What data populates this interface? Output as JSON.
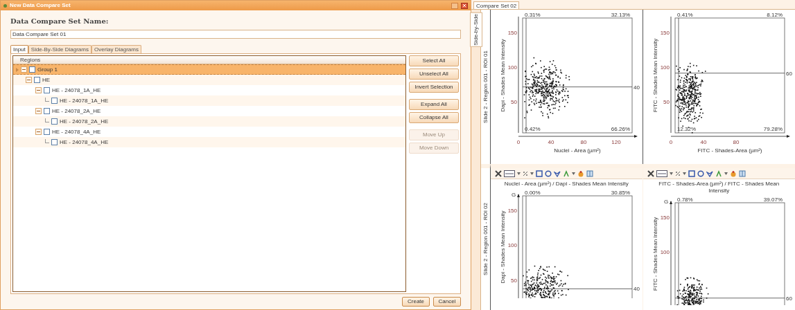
{
  "dialog": {
    "title": "New Data Compare Set",
    "name_label": "Data Compare Set Name:",
    "name_value": "Data Compare Set 01",
    "tabs": [
      {
        "label": "Input",
        "selected": true
      },
      {
        "label": "Side-By-Side Diagrams",
        "selected": false
      },
      {
        "label": "Overlay Diagrams",
        "selected": false
      }
    ],
    "tree": {
      "column": "Regions",
      "items": [
        {
          "label": "Group 1",
          "checked": false,
          "expanded": true,
          "selected": true,
          "children": [
            {
              "label": "HE",
              "checked": false,
              "expanded": true,
              "selected": false,
              "children": [
                {
                  "label": "HE - 24078_1A_HE",
                  "checked": false,
                  "expanded": true,
                  "selected": false,
                  "children": [
                    {
                      "label": "HE - 24078_1A_HE",
                      "checked": false,
                      "selected": false
                    }
                  ]
                },
                {
                  "label": "HE - 24078_2A_HE",
                  "checked": false,
                  "expanded": true,
                  "selected": false,
                  "children": [
                    {
                      "label": "HE - 24078_2A_HE",
                      "checked": false,
                      "selected": false
                    }
                  ]
                },
                {
                  "label": "HE - 24078_4A_HE",
                  "checked": false,
                  "expanded": true,
                  "selected": false,
                  "children": [
                    {
                      "label": "HE - 24078_4A_HE",
                      "checked": false,
                      "selected": false
                    }
                  ]
                }
              ]
            }
          ]
        }
      ]
    },
    "side_buttons": [
      {
        "label": "Select All",
        "disabled": false
      },
      {
        "label": "Unselect All",
        "disabled": false
      },
      {
        "label": "Invert Selection",
        "disabled": false
      },
      {
        "label": "Expand All",
        "disabled": false
      },
      {
        "label": "Collapse All",
        "disabled": false
      },
      {
        "label": "Move Up",
        "disabled": true
      },
      {
        "label": "Move Down",
        "disabled": true
      }
    ],
    "footer_buttons": [
      "Create",
      "Cancel"
    ]
  },
  "compare": {
    "tab": "Compare Set 02",
    "side_tab": "Side-by-Side",
    "row_labels": [
      "Slide 2 - Region 001 - ROI 01",
      "Slide 2 - Region 001 - ROI 02"
    ],
    "plots": [
      {
        "toolbar": false,
        "ylabel": "Dapi - Shades Mean Intensity",
        "xlabel": "Nuclei - Area (µm²)",
        "yticks": [
          "150",
          "100",
          "50"
        ],
        "xticks": [
          "0",
          "40",
          "80",
          "120"
        ],
        "gate": "40",
        "corners": [
          "0.31%",
          "32.13%",
          "0.42%",
          "66.26%"
        ]
      },
      {
        "toolbar": false,
        "ylabel": "FITC - Shades Mean Intensity",
        "xlabel": "FITC - Shades-Area (µm²)",
        "yticks": [
          "150",
          "100",
          "50"
        ],
        "xticks": [
          "0",
          "40",
          "80"
        ],
        "gate": "60",
        "corners": [
          "0.41%",
          "8.12%",
          "12.32%",
          "79.28%"
        ]
      },
      {
        "toolbar": true,
        "title": "Nuclei - Area (µm²) / Dapi - Shades Mean Intensity",
        "axis_mark": "G",
        "ylabel": "Dapi - Shades Mean Intensity",
        "yticks": [
          "150",
          "100",
          "50"
        ],
        "gate": "40",
        "corners": [
          "0.00%",
          "30.85%"
        ]
      },
      {
        "toolbar": true,
        "title": "FITC - Shades-Area (µm²) / FITC - Shades Mean Intensity",
        "axis_mark": "G",
        "ylabel": "FITC - Shades Mean Intensity",
        "yticks": [
          "150",
          "100"
        ],
        "gate": "60",
        "corners": [
          "0.78%",
          "39.07%"
        ]
      }
    ]
  }
}
